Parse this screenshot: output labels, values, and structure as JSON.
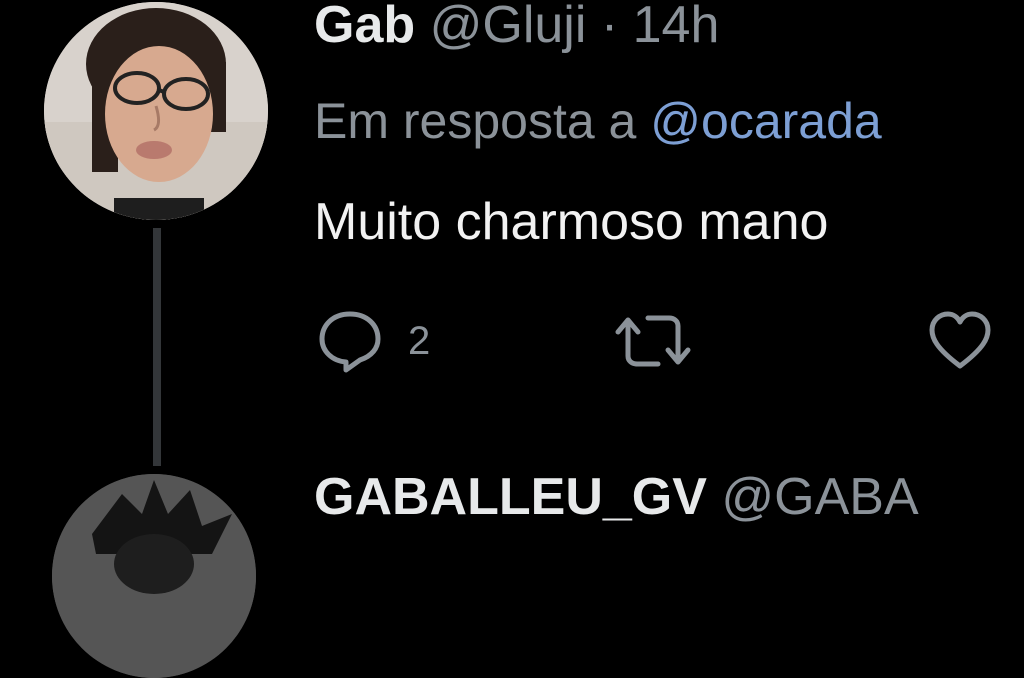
{
  "tweet": {
    "author_name": "Gab",
    "author_handle": "@Gluji",
    "separator": "·",
    "time": "14h",
    "reply_label": "Em resposta a",
    "reply_handle": "@ocarada",
    "text": "Muito charmoso mano",
    "reply_count": "2"
  },
  "next_tweet": {
    "author_name": "GABALLEU_GV",
    "author_handle": "@GABA"
  },
  "icons": {
    "reply": "reply-icon",
    "retweet": "retweet-icon",
    "like": "heart-icon"
  },
  "colors": {
    "background": "#000000",
    "primary_text": "#e7e9ea",
    "secondary_text": "#8b9299",
    "mention": "#7d9fd4",
    "thread_line": "#333639"
  }
}
